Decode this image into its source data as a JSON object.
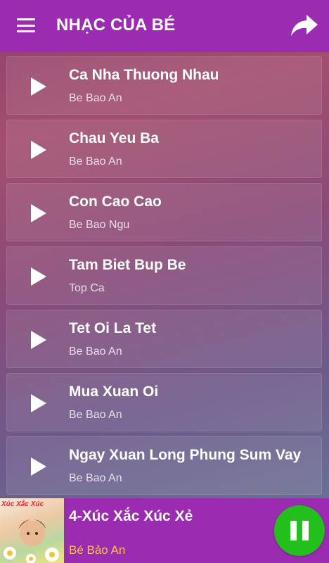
{
  "header": {
    "title": "NHẠC CỦA BÉ",
    "menu_icon": "hamburger-menu-icon",
    "share_icon": "share-arrow-icon"
  },
  "songs": [
    {
      "title": "Ca Nha Thuong Nhau",
      "artist": "Be Bao An"
    },
    {
      "title": "Chau Yeu Ba",
      "artist": "Be Bao An"
    },
    {
      "title": "Con Cao Cao",
      "artist": "Be Bao Ngu"
    },
    {
      "title": "Tam Biet Bup Be",
      "artist": "Top Ca"
    },
    {
      "title": "Tet Oi La Tet",
      "artist": "Be Bao An"
    },
    {
      "title": "Mua Xuan Oi",
      "artist": "Be Bao An"
    },
    {
      "title": "Ngay Xuan Long Phung Sum Vay",
      "artist": "Be Bao An"
    }
  ],
  "player": {
    "title": "4-Xúc Xắc Xúc Xẻ",
    "artist": "Bé Bảo An",
    "cover_text": "Xúc Xắc Xúc",
    "state_icon": "pause-icon"
  },
  "colors": {
    "bar": "#9b2bb0",
    "pause_button": "#23c01d",
    "artist_accent": "#f7c24a"
  }
}
